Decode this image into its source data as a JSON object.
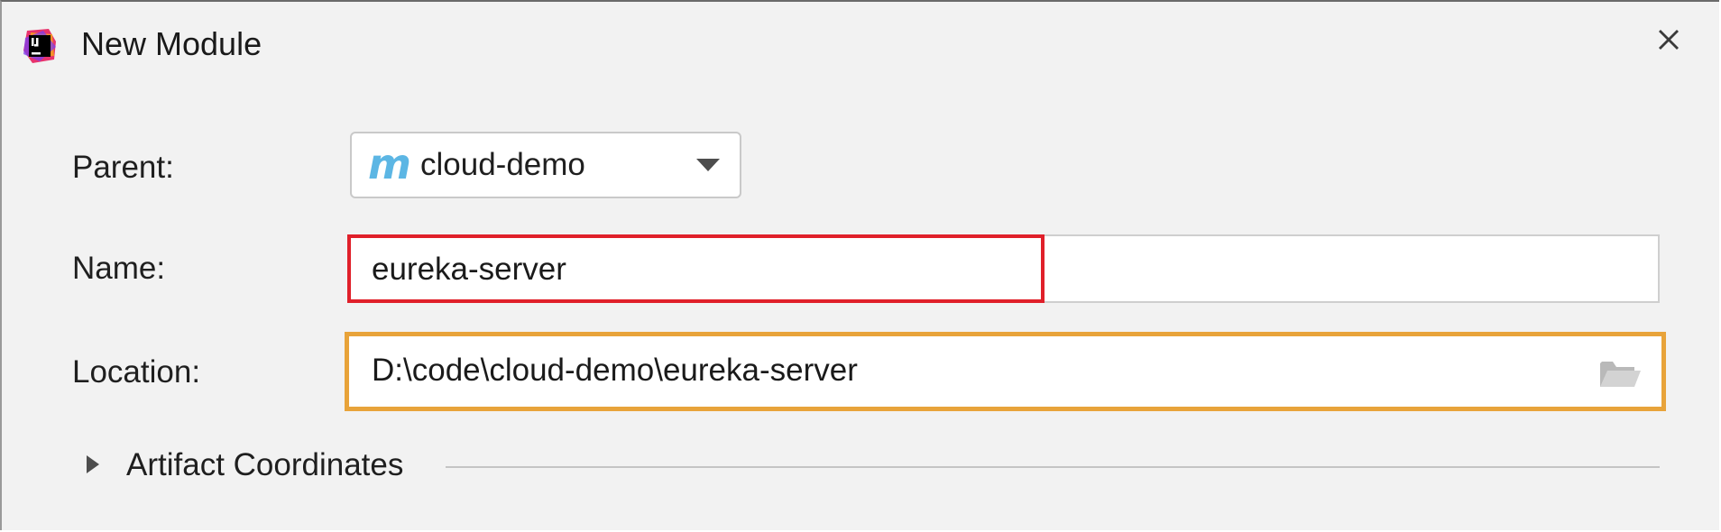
{
  "dialog": {
    "title": "New Module",
    "app_icon": "intellij-idea-icon",
    "close_icon": "close-icon"
  },
  "form": {
    "parent": {
      "label": "Parent:",
      "value": "cloud-demo",
      "icon": "maven-module-icon",
      "icon_glyph": "m"
    },
    "name": {
      "label": "Name:",
      "value": "eureka-server",
      "highlight_color": "#e0202a"
    },
    "location": {
      "label": "Location:",
      "value": "D:\\code\\cloud-demo\\eureka-server",
      "icon": "folder-icon",
      "highlight_color": "#e8a33a"
    },
    "artifact": {
      "label": "Artifact Coordinates",
      "expanded": false
    }
  }
}
